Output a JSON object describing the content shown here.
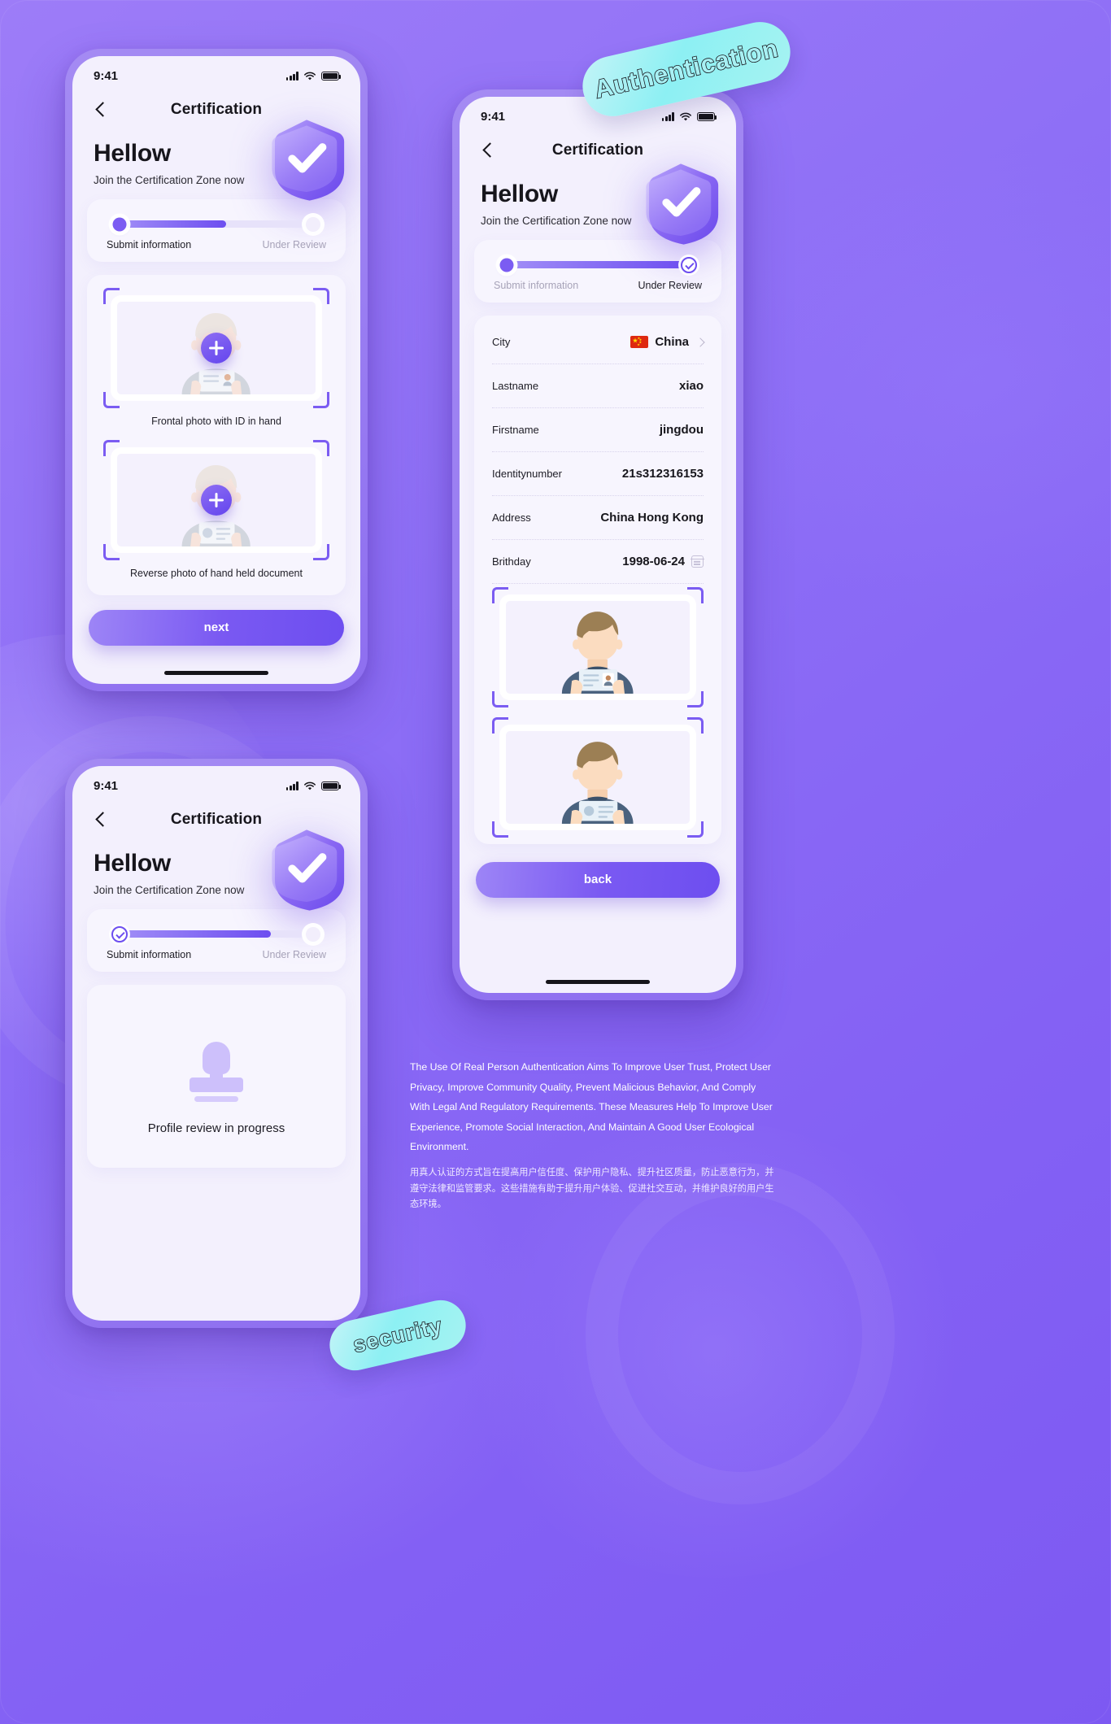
{
  "background": {
    "accent": "#7b5cf2",
    "page_bg": "#8d6ef6",
    "screen_bg": "#f3f0fd"
  },
  "stickers": {
    "authentication": "Authentication",
    "security": "security"
  },
  "phone1": {
    "status": {
      "time": "9:41"
    },
    "nav": {
      "title": "Certification",
      "back_icon": "chevron-left-icon"
    },
    "hero": {
      "title": "Hellow",
      "subtitle": "Join the Certification Zone now",
      "shield_icon": "shield-check-icon"
    },
    "progress": {
      "step_a": "Submit information",
      "step_b": "Under Review",
      "percent": 55,
      "start_done": false,
      "end_done": false
    },
    "uploads": [
      {
        "caption": "Frontal photo with ID in hand",
        "icon": "add-photo-icon",
        "placeholder": true
      },
      {
        "caption": "Reverse photo of hand held document",
        "icon": "add-photo-icon",
        "placeholder": true
      }
    ],
    "button": "next"
  },
  "phone2": {
    "status": {
      "time": "9:41"
    },
    "nav": {
      "title": "Certification",
      "back_icon": "chevron-left-icon"
    },
    "hero": {
      "title": "Hellow",
      "subtitle": "Join the Certification Zone now",
      "shield_icon": "shield-check-icon"
    },
    "progress": {
      "step_a": "Submit information",
      "step_b": "Under Review",
      "percent": 100,
      "start_done": false,
      "end_done": true
    },
    "info_rows": [
      {
        "label": "City",
        "value": "China",
        "flag": "china-flag-icon",
        "chevron": true
      },
      {
        "label": "Lastname",
        "value": "xiao"
      },
      {
        "label": "Firstname",
        "value": "jingdou"
      },
      {
        "label": "Identitynumber",
        "value": "21s312316153"
      },
      {
        "label": "Address",
        "value": "China Hong Kong"
      },
      {
        "label": "Brithday",
        "value": "1998-06-24",
        "calendar": true
      }
    ],
    "photos": [
      {
        "alt": "person-holding-id-front"
      },
      {
        "alt": "person-holding-id-reverse"
      }
    ],
    "button": "back"
  },
  "phone3": {
    "status": {
      "time": "9:41"
    },
    "nav": {
      "title": "Certification",
      "back_icon": "chevron-left-icon"
    },
    "hero": {
      "title": "Hellow",
      "subtitle": "Join the Certification Zone now",
      "shield_icon": "shield-check-icon"
    },
    "progress": {
      "step_a": "Submit information",
      "step_b": "Under Review",
      "percent": 78,
      "start_done": true,
      "end_done": false
    },
    "review": {
      "caption": "Profile review in progress",
      "icon": "stamp-icon"
    }
  },
  "footer": {
    "english": "The Use Of Real Person Authentication Aims To Improve User Trust, Protect User Privacy, Improve Community Quality, Prevent Malicious Behavior, And Comply With Legal And Regulatory Requirements. These Measures Help To Improve User Experience, Promote Social Interaction, And Maintain A Good User Ecological Environment.",
    "chinese": "用真人认证的方式旨在提高用户信任度、保护用户隐私、提升社区质量，防止恶意行为，并遵守法律和监管要求。这些措施有助于提升用户体验、促进社交互动，并维护良好的用户生态环境。"
  }
}
